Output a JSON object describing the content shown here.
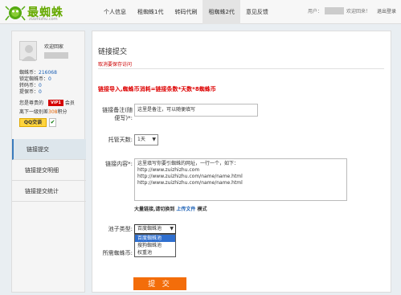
{
  "header": {
    "logo_text": "最蜘蛛",
    "logo_sub": "zuizhizhu.com",
    "nav": [
      {
        "label": "个人信息"
      },
      {
        "label": "租蜘蛛1代"
      },
      {
        "label": "转码代刷"
      },
      {
        "label": "租蜘蛛2代"
      },
      {
        "label": "意见反馈"
      }
    ],
    "active_nav_index": 3,
    "user_prefix": "用户：",
    "welcome_text": "欢迎回来！",
    "logout": "退出登录"
  },
  "sidebar": {
    "welcome": "欢迎回家",
    "stats": [
      {
        "label": "蜘蛛币：",
        "value": "216068"
      },
      {
        "label": "锁定蜘蛛币：",
        "value": "0"
      },
      {
        "label": "转码币：",
        "value": "0"
      },
      {
        "label": "提保币：",
        "value": "0"
      }
    ],
    "vip_prefix": "您是尊贵的",
    "vip_badge": "VIP1",
    "vip_suffix": "会员",
    "next_level_prefix": "离下一级别差",
    "next_level_value": "308",
    "next_level_suffix": "积分",
    "qq_label": "QQ交谈",
    "menu": [
      {
        "label": "链接提交"
      },
      {
        "label": "链接提交明细"
      },
      {
        "label": "链接提交统计"
      }
    ]
  },
  "main": {
    "title": "链接提交",
    "desc": "取消要保存访问",
    "rule": "链接导入,蜘蛛币消耗=链接条数*天数*8蜘蛛币",
    "remark_label": "链接备注(随便写)*:",
    "remark_value": "这里是备注，可以随便填写",
    "days_label": "托管天数:",
    "days_value": "1天",
    "content_label": "链接内容*:",
    "content_lines": [
      "这里填写你要引蜘蛛的网址，一行一个，如下：",
      "http://www.zuizhizhu.com",
      "http://www.zuizhizhu.com/name/name.html",
      "http://www.zuizhizhu.com/name/name.html"
    ],
    "upload_prefix": "大量链接,请切换到",
    "upload_link": "上传文件",
    "upload_suffix": "模式",
    "pool_label": "池子类型:",
    "pool_value": "百度蜘蛛池",
    "pool_options": [
      "百度蜘蛛池",
      "搜狗蜘蛛池",
      "权重池"
    ],
    "pool_selected_index": 0,
    "cost_label": "所需蜘蛛币:",
    "submit": "提 交"
  },
  "colors": {
    "accent": "#f36d0a",
    "logo_green": "#66aa00",
    "warning_red": "#d00000",
    "link_blue": "#1a5fb4"
  }
}
